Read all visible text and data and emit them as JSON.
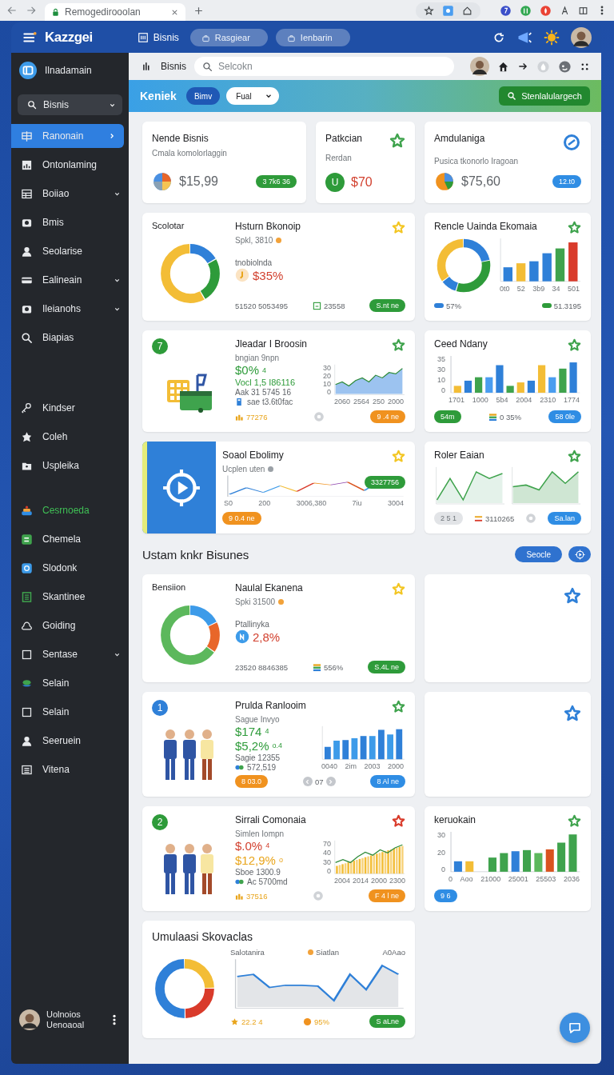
{
  "browser": {
    "tab_title": "Remogedirooolan"
  },
  "header": {
    "logo": "Kazzgei",
    "nav": [
      {
        "label": "Bisnis",
        "kind": "link"
      },
      {
        "label": "Rasgiear",
        "kind": "pill"
      },
      {
        "label": "Ienbarin",
        "kind": "pill"
      }
    ]
  },
  "sidebar": {
    "workspace": "Ilnadamain",
    "dropdown": "Bisnis",
    "groups": [
      {
        "items": [
          {
            "label": "Ranonain",
            "expandable": false,
            "selected": true,
            "highlighted": false
          },
          {
            "label": "Ontonlaming",
            "expandable": false,
            "selected": false,
            "highlighted": false
          },
          {
            "label": "Boiiao",
            "expandable": true,
            "selected": false,
            "highlighted": false
          },
          {
            "label": "Bmis",
            "expandable": false,
            "selected": false,
            "highlighted": false
          },
          {
            "label": "Seolarise",
            "expandable": false,
            "selected": false,
            "highlighted": false
          },
          {
            "label": "Ealineain",
            "expandable": true,
            "selected": false,
            "highlighted": false
          },
          {
            "label": "Ileianohs",
            "expandable": true,
            "selected": false,
            "highlighted": false
          },
          {
            "label": "Biapias",
            "expandable": false,
            "selected": false,
            "highlighted": false
          }
        ]
      },
      {
        "items": [
          {
            "label": "Kindser",
            "expandable": false,
            "selected": false,
            "highlighted": false
          },
          {
            "label": "Coleh",
            "expandable": false,
            "selected": false,
            "highlighted": false
          },
          {
            "label": "Uspleika",
            "expandable": false,
            "selected": false,
            "highlighted": false
          }
        ]
      },
      {
        "items": [
          {
            "label": "Cesrnoeda",
            "expandable": false,
            "selected": false,
            "highlighted": true
          },
          {
            "label": "Chemela",
            "expandable": false,
            "selected": false,
            "highlighted": false
          },
          {
            "label": "Slodonk",
            "expandable": false,
            "selected": false,
            "highlighted": false
          },
          {
            "label": "Skantinee",
            "expandable": false,
            "selected": false,
            "highlighted": false
          },
          {
            "label": "Goiding",
            "expandable": false,
            "selected": false,
            "highlighted": false
          },
          {
            "label": "Sentase",
            "expandable": true,
            "selected": false,
            "highlighted": false
          },
          {
            "label": "Selain",
            "expandable": false,
            "selected": false,
            "highlighted": false
          },
          {
            "label": "Selain",
            "expandable": false,
            "selected": false,
            "highlighted": false
          },
          {
            "label": "Seeruein",
            "expandable": false,
            "selected": false,
            "highlighted": false
          },
          {
            "label": "Vitena",
            "expandable": false,
            "selected": false,
            "highlighted": false
          }
        ]
      }
    ],
    "user": {
      "name": "Uolnoios",
      "role": "Uenoaoal"
    }
  },
  "topbar": {
    "title": "Bisnis",
    "search_placeholder": "Selcokn"
  },
  "banner": {
    "title": "Keniek",
    "chip": "Bimv",
    "dropdown": "Fual",
    "action": "Stenlalulargech"
  },
  "cards": [
    {
      "kind": "stat",
      "title": "Nende Bisnis",
      "subtitle": "Cmala komolorlaggin",
      "value": "$15,99",
      "badge": {
        "text": "3 7k6 36",
        "color": "#2e9b3a"
      }
    },
    {
      "kind": "stat",
      "title": "Patkcian",
      "subtitle": "Rerdan",
      "letter": "U",
      "value": "$70",
      "star": {
        "color": "#3fa34d"
      }
    },
    {
      "kind": "stat",
      "title": "Amdulaniga",
      "subtitle": "Pusica tkonorlo Iragoan",
      "value": "$75,60",
      "badge": {
        "text": "12.t0",
        "color": "#2f8de4"
      }
    },
    {
      "kind": "feature",
      "visual_label": "Scolotar",
      "title": "Hsturn Bkonoip",
      "subtitle": "Spkl, 3810",
      "dot": {
        "color": "#f2a23a"
      },
      "star": {
        "color": "#f3c623"
      },
      "lines": [
        {
          "text": "tnobiolnda"
        },
        {
          "text": "$35%"
        }
      ],
      "footer": [
        {
          "kind": "text",
          "text": "51520 5053495"
        },
        {
          "kind": "text",
          "text": "23558"
        },
        {
          "kind": "badge",
          "text": "S.nt ne",
          "color": "#2e9b3a"
        }
      ]
    },
    {
      "kind": "chart",
      "title": "Rencle Uainda Ekomaia",
      "star": {
        "color": "#3fa34d"
      },
      "x_labels": [
        "0t0",
        "52",
        "3b9",
        "34",
        "501"
      ],
      "footer": [
        {
          "kind": "legend",
          "text": "57%",
          "color": "#2f80d8"
        },
        {
          "kind": "legend",
          "text": "51.3195",
          "color": "#2e9b3a"
        }
      ]
    },
    {
      "kind": "feature",
      "number": {
        "text": "7",
        "color": "#2e9b3a"
      },
      "title": "Jleadar I Broosin",
      "subtitle": "bngian 9npn",
      "star": {
        "color": "#3fa34d"
      },
      "lines": [
        {
          "text": "$0%",
          "suffix": "4"
        },
        {
          "text": "Vocl 1,5 I86116"
        },
        {
          "text": "Aak 31 5745 16"
        },
        {
          "text": "sae t3.6t0fac"
        }
      ],
      "chart": {
        "y_labels": [
          "30",
          "20",
          "10",
          "0"
        ],
        "x_labels": [
          "2060",
          "2564",
          "250",
          "2000"
        ]
      },
      "footer": [
        {
          "kind": "text",
          "text": "77276"
        },
        {
          "kind": "icon"
        },
        {
          "kind": "badge",
          "text": "9 .4 ne",
          "color": "#f0921f"
        }
      ]
    },
    {
      "kind": "chart",
      "title": "Ceed Ndany",
      "star": {
        "color": "#3fa34d"
      },
      "y_labels": [
        "35",
        "30",
        "10",
        "0"
      ],
      "x_labels": [
        "1701",
        "1000",
        "5b4",
        "2004",
        "2310",
        "1774"
      ],
      "footer": [
        {
          "kind": "badge",
          "text": "54m",
          "color": "#2e9b3a"
        },
        {
          "kind": "text",
          "text": "0 35%"
        },
        {
          "kind": "badge",
          "text": "58 0le",
          "color": "#2f8de4"
        }
      ]
    },
    {
      "kind": "feature",
      "title": "Soaol Ebolimy",
      "subtitle": "Ucplen uten",
      "dot": {
        "color": "#9aa0a6"
      },
      "star": {
        "color": "#f3c623"
      },
      "chart": {
        "x_labels": [
          "S0",
          "200",
          "3006,380",
          "7iu",
          "3004"
        ],
        "badge": {
          "text": "3327756",
          "color": "#2e9b3a"
        }
      },
      "footer": [
        {
          "kind": "badge",
          "text": "9 0.4 ne",
          "color": "#f0921f"
        }
      ]
    },
    {
      "kind": "chart",
      "title": "Roler Eaian",
      "star": {
        "color": "#3fa34d"
      },
      "footer": [
        {
          "kind": "badge",
          "text": "2 5 1",
          "color": "#e2e4e7"
        },
        {
          "kind": "text",
          "text": "3110265"
        },
        {
          "kind": "icon"
        },
        {
          "kind": "badge",
          "text": "Sa.lan",
          "color": "#2f8de4"
        }
      ]
    }
  ],
  "section": {
    "title": "Ustam knkr Bisunes",
    "button": "Seocle"
  },
  "section_cards": [
    {
      "kind": "feature",
      "visual_label": "Bensiion",
      "title": "Naulal Ekanena",
      "subtitle": "Spki 31500",
      "dot": {
        "color": "#f2a23a"
      },
      "star": {
        "color": "#f3c623"
      },
      "lines": [
        {
          "text": "Ptallinyka"
        },
        {
          "text": "2,8%"
        }
      ],
      "footer": [
        {
          "kind": "text",
          "text": "23520 8846385"
        },
        {
          "kind": "text",
          "text": "556%"
        },
        {
          "kind": "badge",
          "text": "S.4L ne",
          "color": "#2e9b3a"
        }
      ]
    },
    {
      "kind": "empty",
      "star": {
        "color": "#2f80d8"
      }
    },
    {
      "kind": "feature",
      "number": {
        "text": "1",
        "color": "#2f80d8"
      },
      "title": "Prulda Ranlooim",
      "subtitle": "Sague Invyo",
      "star": {
        "color": "#3fa34d"
      },
      "lines": [
        {
          "text": "$174",
          "suffix": "4"
        },
        {
          "text": "$5,2%",
          "suffix": "o.4"
        },
        {
          "text": "Sagie 12355"
        },
        {
          "text": "572,519"
        }
      ],
      "chart": {
        "x_labels": [
          "0040",
          "2im",
          "2003",
          "2000"
        ]
      },
      "footer": [
        {
          "kind": "badge",
          "text": "8 03.0",
          "color": "#f0921f"
        },
        {
          "kind": "pager",
          "text": "07"
        },
        {
          "kind": "badge",
          "text": "8 Al ne",
          "color": "#2f8de4"
        }
      ]
    },
    {
      "kind": "empty",
      "star": {
        "color": "#2f80d8"
      }
    },
    {
      "kind": "feature",
      "number": {
        "text": "2",
        "color": "#2e9b3a"
      },
      "title": "Sirrali Comonaia",
      "subtitle": "Simlen Iompn",
      "star": {
        "color": "#d93b2b"
      },
      "lines": [
        {
          "text": "$.0%",
          "suffix": "4"
        },
        {
          "text": "$12,9%",
          "suffix": "o"
        },
        {
          "text": "Sboe 1300.9"
        },
        {
          "text": "Ac 5700md"
        }
      ],
      "chart": {
        "y_labels": [
          "70",
          "40",
          "30",
          "0"
        ],
        "x_labels": [
          "2004",
          "2014",
          "2000",
          "2300"
        ]
      },
      "footer": [
        {
          "kind": "text",
          "text": "37516"
        },
        {
          "kind": "icon"
        },
        {
          "kind": "badge",
          "text": "F 4 l ne",
          "color": "#f0921f"
        }
      ]
    },
    {
      "kind": "chart",
      "title": "keruokain",
      "star": {
        "color": "#3fa34d"
      },
      "y_labels": [
        "30",
        "20",
        "0"
      ],
      "x_labels": [
        "0",
        "Aoo",
        "21000",
        "25001",
        "25503",
        "2036"
      ],
      "footer": [
        {
          "kind": "badge",
          "text": "9 6",
          "color": "#2f8de4"
        }
      ]
    },
    {
      "kind": "summary",
      "title": "Umulaasi Skovaclas",
      "chart": {
        "legend": [
          {
            "text": "Salotanira"
          },
          {
            "text": "Siatlan",
            "color": "#f2a23a"
          },
          {
            "text": "A0Aao"
          }
        ]
      },
      "footer": [
        {
          "kind": "text",
          "text": "22.2 4"
        },
        {
          "kind": "text",
          "text": "95%"
        },
        {
          "kind": "badge",
          "text": "S aLne",
          "color": "#2e9b3a"
        }
      ]
    }
  ]
}
